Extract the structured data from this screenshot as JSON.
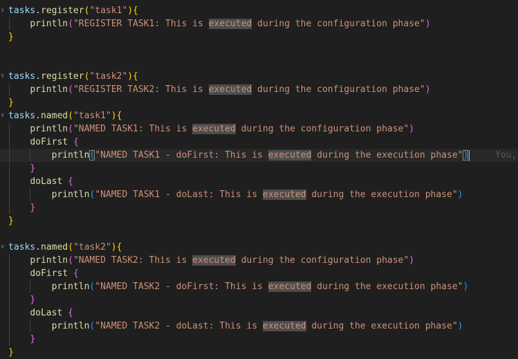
{
  "editor": {
    "lines": [
      [
        {
          "t": "tasks",
          "c": "obj"
        },
        {
          "t": ".",
          "c": "pn"
        },
        {
          "t": "register",
          "c": "fn"
        },
        {
          "t": "(",
          "c": "p1"
        },
        {
          "t": "\"task1\"",
          "c": "str"
        },
        {
          "t": ")",
          "c": "p1"
        },
        {
          "t": "{",
          "c": "p1"
        }
      ],
      [
        {
          "t": "    "
        },
        {
          "t": "println",
          "c": "fn"
        },
        {
          "t": "(",
          "c": "p2"
        },
        {
          "t": "\"REGISTER TASK1: This is ",
          "c": "str"
        },
        {
          "t": "executed",
          "c": "str",
          "hl": true
        },
        {
          "t": " during the configuration phase\"",
          "c": "str"
        },
        {
          "t": ")",
          "c": "p2"
        }
      ],
      [
        {
          "t": "}",
          "c": "p1"
        }
      ],
      [],
      [],
      [
        {
          "t": "tasks",
          "c": "obj"
        },
        {
          "t": ".",
          "c": "pn"
        },
        {
          "t": "register",
          "c": "fn"
        },
        {
          "t": "(",
          "c": "p1"
        },
        {
          "t": "\"task2\"",
          "c": "str"
        },
        {
          "t": ")",
          "c": "p1"
        },
        {
          "t": "{",
          "c": "p1"
        }
      ],
      [
        {
          "t": "    "
        },
        {
          "t": "println",
          "c": "fn"
        },
        {
          "t": "(",
          "c": "p2"
        },
        {
          "t": "\"REGISTER TASK2: This is ",
          "c": "str"
        },
        {
          "t": "executed",
          "c": "str",
          "hl": true
        },
        {
          "t": " during the configuration phase\"",
          "c": "str"
        },
        {
          "t": ")",
          "c": "p2"
        }
      ],
      [
        {
          "t": "}",
          "c": "p1"
        }
      ],
      [
        {
          "t": "tasks",
          "c": "obj"
        },
        {
          "t": ".",
          "c": "pn"
        },
        {
          "t": "named",
          "c": "fn"
        },
        {
          "t": "(",
          "c": "p1"
        },
        {
          "t": "\"task1\"",
          "c": "str"
        },
        {
          "t": ")",
          "c": "p1"
        },
        {
          "t": "{",
          "c": "p1"
        }
      ],
      [
        {
          "t": "    "
        },
        {
          "t": "println",
          "c": "fn"
        },
        {
          "t": "(",
          "c": "p2"
        },
        {
          "t": "\"NAMED TASK1: This is ",
          "c": "str"
        },
        {
          "t": "executed",
          "c": "str",
          "hl": true
        },
        {
          "t": " during the configuration phase\"",
          "c": "str"
        },
        {
          "t": ")",
          "c": "p2"
        }
      ],
      [
        {
          "t": "    "
        },
        {
          "t": "doFirst",
          "c": "fn"
        },
        {
          "t": " "
        },
        {
          "t": "{",
          "c": "p2"
        }
      ],
      [
        {
          "t": "        "
        },
        {
          "t": "println",
          "c": "fn"
        },
        {
          "t": "(",
          "c": "p3",
          "bm": true
        },
        {
          "t": "\"NAMED TASK1 - doFirst: This is ",
          "c": "str"
        },
        {
          "t": "executed",
          "c": "str",
          "hl": true
        },
        {
          "t": " during the execution phase\"",
          "c": "str"
        },
        {
          "t": ")",
          "c": "p3",
          "bm": true,
          "cursor": true
        }
      ],
      [
        {
          "t": "    "
        },
        {
          "t": "}",
          "c": "p2"
        }
      ],
      [
        {
          "t": "    "
        },
        {
          "t": "doLast",
          "c": "fn"
        },
        {
          "t": " "
        },
        {
          "t": "{",
          "c": "p2"
        }
      ],
      [
        {
          "t": "        "
        },
        {
          "t": "println",
          "c": "fn"
        },
        {
          "t": "(",
          "c": "p3"
        },
        {
          "t": "\"NAMED TASK1 - doLast: This is ",
          "c": "str"
        },
        {
          "t": "executed",
          "c": "str",
          "hl": true
        },
        {
          "t": " during the execution phase\"",
          "c": "str"
        },
        {
          "t": ")",
          "c": "p3"
        }
      ],
      [
        {
          "t": "    "
        },
        {
          "t": "}",
          "c": "p2"
        }
      ],
      [
        {
          "t": "}",
          "c": "p1"
        }
      ],
      [],
      [
        {
          "t": "tasks",
          "c": "obj"
        },
        {
          "t": ".",
          "c": "pn"
        },
        {
          "t": "named",
          "c": "fn"
        },
        {
          "t": "(",
          "c": "p1"
        },
        {
          "t": "\"task2\"",
          "c": "str"
        },
        {
          "t": ")",
          "c": "p1"
        },
        {
          "t": "{",
          "c": "p1"
        }
      ],
      [
        {
          "t": "    "
        },
        {
          "t": "println",
          "c": "fn"
        },
        {
          "t": "(",
          "c": "p2"
        },
        {
          "t": "\"NAMED TASK2: This is ",
          "c": "str"
        },
        {
          "t": "executed",
          "c": "str",
          "hl": true
        },
        {
          "t": " during the configuration phase\"",
          "c": "str"
        },
        {
          "t": ")",
          "c": "p2"
        }
      ],
      [
        {
          "t": "    "
        },
        {
          "t": "doFirst",
          "c": "fn"
        },
        {
          "t": " "
        },
        {
          "t": "{",
          "c": "p2"
        }
      ],
      [
        {
          "t": "        "
        },
        {
          "t": "println",
          "c": "fn"
        },
        {
          "t": "(",
          "c": "p3"
        },
        {
          "t": "\"NAMED TASK2 - doFirst: This is ",
          "c": "str"
        },
        {
          "t": "executed",
          "c": "str",
          "hl": true
        },
        {
          "t": " during the execution phase\"",
          "c": "str"
        },
        {
          "t": ")",
          "c": "p3"
        }
      ],
      [
        {
          "t": "    "
        },
        {
          "t": "}",
          "c": "p2"
        }
      ],
      [
        {
          "t": "    "
        },
        {
          "t": "doLast",
          "c": "fn"
        },
        {
          "t": " "
        },
        {
          "t": "{",
          "c": "p2"
        }
      ],
      [
        {
          "t": "        "
        },
        {
          "t": "println",
          "c": "fn"
        },
        {
          "t": "(",
          "c": "p3"
        },
        {
          "t": "\"NAMED TASK2 - doLast: This is ",
          "c": "str"
        },
        {
          "t": "executed",
          "c": "str",
          "hl": true
        },
        {
          "t": " during the execution phase\"",
          "c": "str"
        },
        {
          "t": ")",
          "c": "p3"
        }
      ],
      [
        {
          "t": "    "
        },
        {
          "t": "}",
          "c": "p2"
        }
      ],
      [
        {
          "t": "}",
          "c": "p1"
        }
      ]
    ],
    "current_line": 11,
    "blame_text": "You,",
    "fold_marker": "∨"
  }
}
